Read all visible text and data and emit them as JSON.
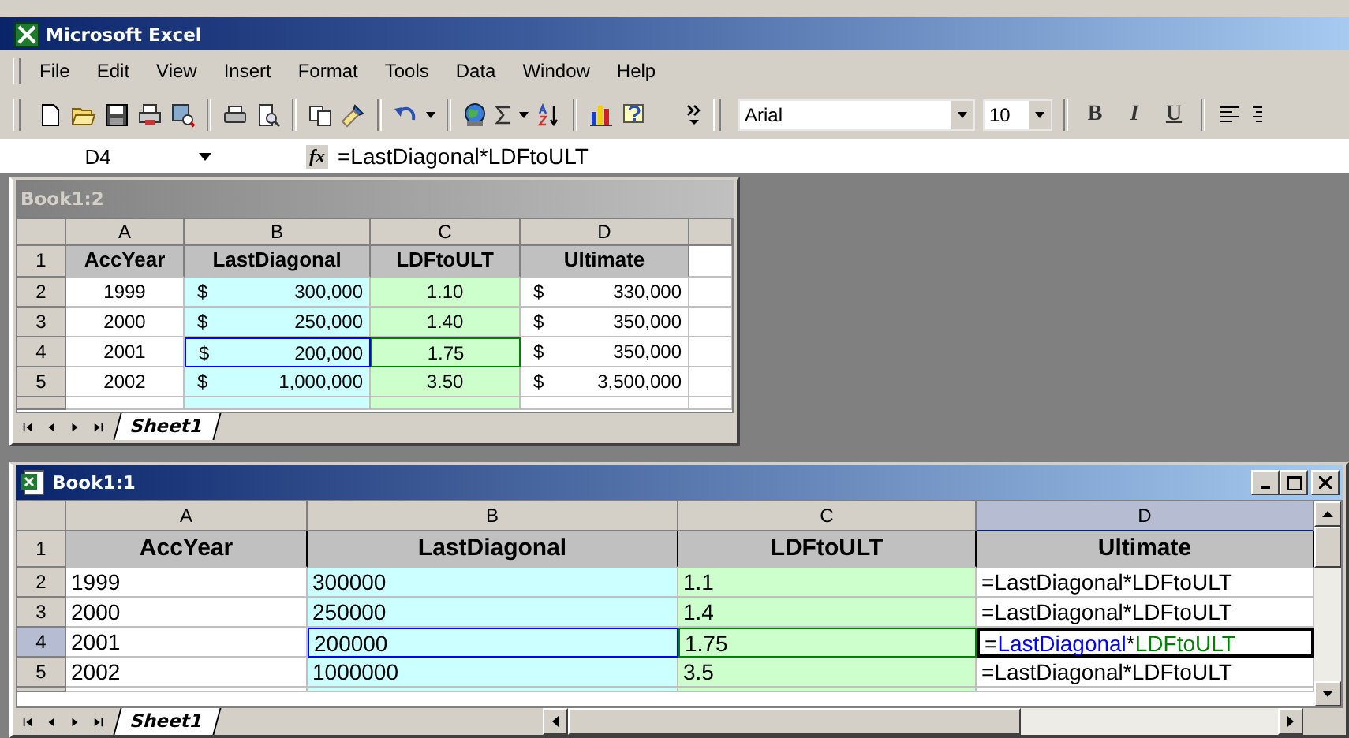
{
  "window": {
    "title": "Microsoft Excel"
  },
  "menu": [
    "File",
    "Edit",
    "View",
    "Insert",
    "Format",
    "Tools",
    "Data",
    "Window",
    "Help"
  ],
  "toolbar": {
    "font": "Arial",
    "size": "10",
    "format_buttons": [
      "B",
      "I",
      "U"
    ]
  },
  "formula_bar": {
    "name_box": "D4",
    "function_label": "fx",
    "formula": "=LastDiagonal*LDFtoULT"
  },
  "workbooks": [
    {
      "title": "Book1:2",
      "active": false,
      "kind": "formatted",
      "columns": [
        {
          "label": "A",
          "selected": false
        },
        {
          "label": "B",
          "selected": false,
          "color": "#ccffff"
        },
        {
          "label": "C",
          "selected": false,
          "color": "#ccffcc"
        },
        {
          "label": "D",
          "selected": false
        }
      ],
      "rows": [
        {
          "label": "1",
          "selected": false,
          "kind": "header",
          "cells": [
            {
              "text": "AccYear"
            },
            {
              "text": "LastDiagonal"
            },
            {
              "text": "LDFtoULT"
            },
            {
              "text": "Ultimate"
            }
          ]
        },
        {
          "label": "2",
          "selected": false,
          "cells": [
            {
              "text": "1999"
            },
            {
              "currency": "$",
              "text": "300,000"
            },
            {
              "text": "1.10"
            },
            {
              "currency": "$",
              "text": "330,000"
            }
          ]
        },
        {
          "label": "3",
          "selected": false,
          "cells": [
            {
              "text": "2000"
            },
            {
              "currency": "$",
              "text": "250,000"
            },
            {
              "text": "1.40"
            },
            {
              "currency": "$",
              "text": "350,000"
            }
          ]
        },
        {
          "label": "4",
          "selected": false,
          "cells": [
            {
              "text": "2001"
            },
            {
              "currency": "$",
              "text": "200,000",
              "color": "#0000ff"
            },
            {
              "text": "1.75",
              "color": "#008000"
            },
            {
              "currency": "$",
              "text": "350,000"
            }
          ]
        },
        {
          "label": "5",
          "selected": false,
          "cells": [
            {
              "text": "2002"
            },
            {
              "currency": "$",
              "text": "1,000,000"
            },
            {
              "text": "3.50"
            },
            {
              "currency": "$",
              "text": "3,500,000"
            }
          ]
        }
      ],
      "sheet_tabs": [
        {
          "label": "Sheet1",
          "selected": true
        }
      ]
    },
    {
      "title": "Book1:1",
      "active": true,
      "kind": "plain",
      "columns": [
        {
          "label": "A",
          "selected": false
        },
        {
          "label": "B",
          "selected": false,
          "color": "#ccffff"
        },
        {
          "label": "C",
          "selected": false,
          "color": "#ccffcc"
        },
        {
          "label": "D",
          "selected": true
        }
      ],
      "rows": [
        {
          "label": "1",
          "selected": false,
          "kind": "header",
          "cells": [
            {
              "text": "AccYear"
            },
            {
              "text": "LastDiagonal"
            },
            {
              "text": "LDFtoULT"
            },
            {
              "text": "Ultimate"
            }
          ]
        },
        {
          "label": "2",
          "selected": false,
          "cells": [
            {
              "text": "1999"
            },
            {
              "text": "300000"
            },
            {
              "text": "1.1"
            },
            {
              "text": "=LastDiagonal*LDFtoULT"
            }
          ]
        },
        {
          "label": "3",
          "selected": false,
          "cells": [
            {
              "text": "2000"
            },
            {
              "text": "250000"
            },
            {
              "text": "1.4"
            },
            {
              "text": "=LastDiagonal*LDFtoULT"
            }
          ]
        },
        {
          "label": "4",
          "selected": true,
          "cells": [
            {
              "text": "2001"
            },
            {
              "text": "200000",
              "color": "#0000ff"
            },
            {
              "text": "1.75",
              "color": "#008000"
            },
            {
              "active": true,
              "parts": [
                {
                  "text": "="
                },
                {
                  "text": "LastDiagonal",
                  "color": "#0000ff"
                },
                {
                  "text": "*"
                },
                {
                  "text": "LDFtoULT",
                  "color": "#008000"
                }
              ]
            }
          ]
        },
        {
          "label": "5",
          "selected": false,
          "cells": [
            {
              "text": "2002"
            },
            {
              "text": "1000000"
            },
            {
              "text": "3.5"
            },
            {
              "text": "=LastDiagonal*LDFtoULT"
            }
          ]
        }
      ],
      "sheet_tabs": [
        {
          "label": "Sheet1",
          "selected": true
        }
      ]
    }
  ]
}
